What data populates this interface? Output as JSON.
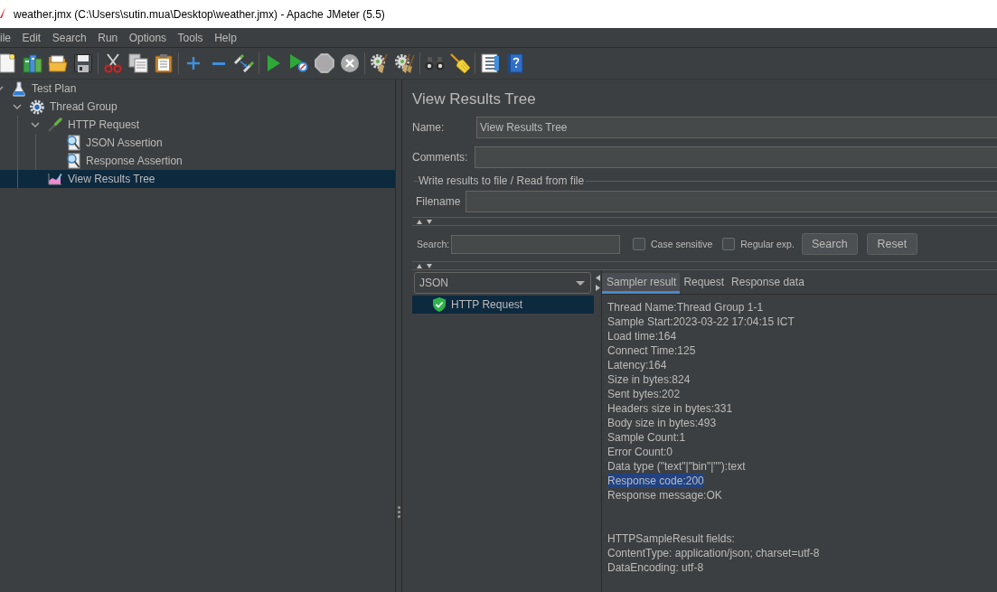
{
  "window": {
    "title": "weather.jmx (C:\\Users\\sutin.mua\\Desktop\\weather.jmx) - Apache JMeter (5.5)"
  },
  "menu": [
    "ile",
    "Edit",
    "Search",
    "Run",
    "Options",
    "Tools",
    "Help"
  ],
  "toolbar": [
    {
      "tools": [
        {
          "kind": "new",
          "disabled": false
        },
        {
          "kind": "templates",
          "disabled": false
        },
        {
          "kind": "open",
          "disabled": false
        },
        {
          "kind": "save",
          "disabled": false
        }
      ]
    },
    {
      "tools": [
        {
          "kind": "cut",
          "disabled": false
        },
        {
          "kind": "copy",
          "disabled": false
        },
        {
          "kind": "paste",
          "disabled": false
        }
      ]
    },
    {
      "tools": [
        {
          "kind": "expand",
          "disabled": false
        },
        {
          "kind": "collapse",
          "disabled": false
        },
        {
          "kind": "toggle",
          "disabled": false
        }
      ]
    },
    {
      "tools": [
        {
          "kind": "start",
          "disabled": false
        },
        {
          "kind": "start_no_pauses",
          "disabled": false
        },
        {
          "kind": "stop",
          "disabled": true
        },
        {
          "kind": "shutdown",
          "disabled": true
        }
      ]
    },
    {
      "tools": [
        {
          "kind": "clear",
          "disabled": false
        },
        {
          "kind": "clear_all",
          "disabled": false
        }
      ]
    },
    {
      "tools": [
        {
          "kind": "search",
          "disabled": false
        },
        {
          "kind": "reset_search",
          "disabled": false
        }
      ]
    },
    {
      "tools": [
        {
          "kind": "function_helper",
          "disabled": false
        },
        {
          "kind": "help",
          "disabled": false
        }
      ]
    }
  ],
  "test_plan_tree": [
    {
      "label": "Test Plan",
      "kind": "test_plan",
      "expanded": true,
      "selected": false,
      "children": [
        {
          "label": "Thread Group",
          "kind": "thread_group",
          "expanded": true,
          "selected": false,
          "children": [
            {
              "label": "HTTP Request",
              "kind": "sampler",
              "expanded": true,
              "selected": false,
              "children": [
                {
                  "label": "JSON Assertion",
                  "kind": "assertion",
                  "selected": false
                },
                {
                  "label": "Response Assertion",
                  "kind": "assertion",
                  "selected": false
                }
              ]
            },
            {
              "label": "View Results Tree",
              "kind": "listener",
              "selected": true
            }
          ]
        }
      ]
    }
  ],
  "panel": {
    "title": "View Results Tree",
    "name_label": "Name:",
    "name_value": "View Results Tree",
    "comments_label": "Comments:",
    "file_section_title": "Write results to file / Read from file",
    "filename_label": "Filename"
  },
  "search": {
    "label": "Search:",
    "options": [
      {
        "label": "Case sensitive",
        "checked": false
      },
      {
        "label": "Regular exp.",
        "checked": false
      }
    ],
    "buttons": [
      "Search",
      "Reset"
    ]
  },
  "renderer": {
    "value": "JSON"
  },
  "results": [
    {
      "label": "HTTP Request",
      "passed": true,
      "selected": true
    }
  ],
  "tabs": [
    {
      "label": "Sampler result",
      "selected": true
    },
    {
      "label": "Request",
      "selected": false
    },
    {
      "label": "Response data",
      "selected": false
    }
  ],
  "sampler_result": [
    {
      "lines": [
        {
          "text": "Thread Name:Thread Group 1-1",
          "highlighted": false
        },
        {
          "text": "Sample Start:2023-03-22 17:04:15 ICT",
          "highlighted": false
        },
        {
          "text": "Load time:164",
          "highlighted": false
        },
        {
          "text": "Connect Time:125",
          "highlighted": false
        },
        {
          "text": "Latency:164",
          "highlighted": false
        },
        {
          "text": "Size in bytes:824",
          "highlighted": false
        },
        {
          "text": "Sent bytes:202",
          "highlighted": false
        },
        {
          "text": "Headers size in bytes:331",
          "highlighted": false
        },
        {
          "text": "Body size in bytes:493",
          "highlighted": false
        },
        {
          "text": "Sample Count:1",
          "highlighted": false
        },
        {
          "text": "Error Count:0",
          "highlighted": false
        },
        {
          "text": "Data type (\"text\"|\"bin\"|\"\"):text",
          "highlighted": false
        },
        {
          "text": "Response code:200",
          "highlighted": true
        },
        {
          "text": "Response message:OK",
          "highlighted": false
        }
      ]
    },
    {
      "lines": [
        {
          "text": "HTTPSampleResult fields:",
          "highlighted": false
        },
        {
          "text": "ContentType: application/json; charset=utf-8",
          "highlighted": false
        },
        {
          "text": "DataEncoding: utf-8",
          "highlighted": false
        }
      ]
    }
  ]
}
